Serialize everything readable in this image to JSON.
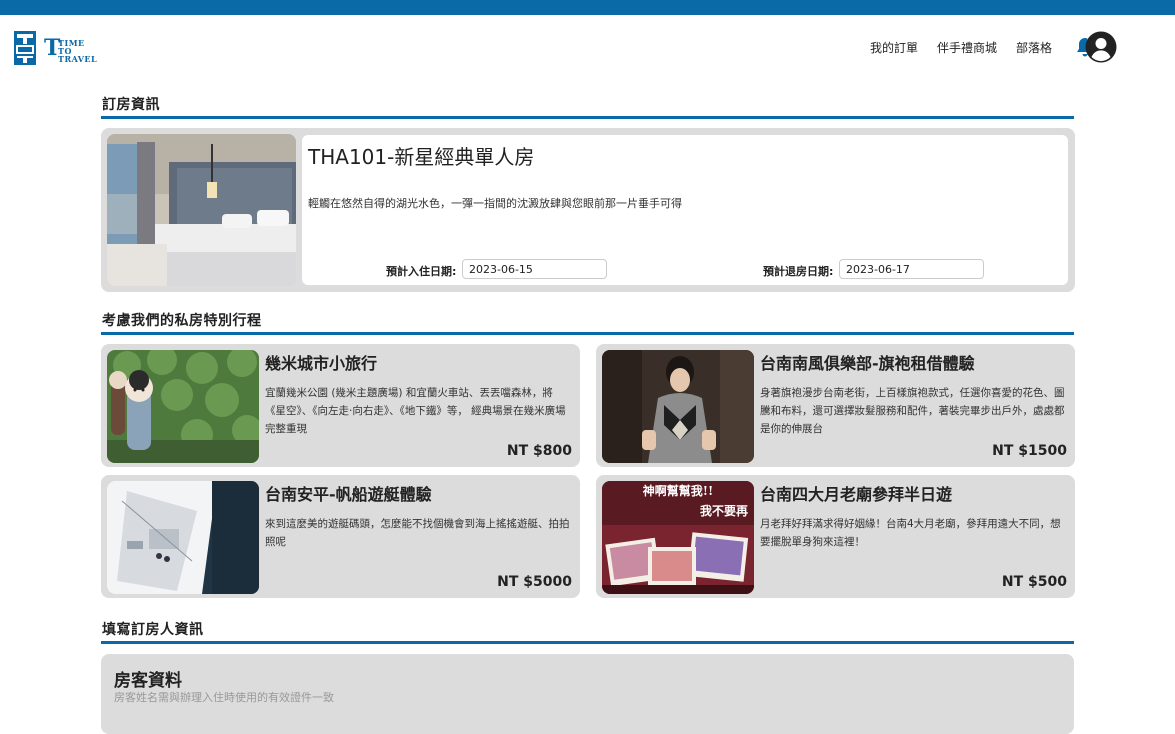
{
  "brand": {
    "name_lines": [
      "TIME",
      "TO",
      "TRAVEL"
    ],
    "color": "#0a6aa8"
  },
  "nav": {
    "items": [
      "我的訂單",
      "伴手禮商城",
      "部落格"
    ]
  },
  "sections": {
    "booking": "訂房資訊",
    "tours": "考慮我們的私房特別行程",
    "guest": "填寫訂房人資訊"
  },
  "booking": {
    "room_title": "THA101-新星經典單人房",
    "description": "輕觸在悠然自得的湖光水色，一彈一指間的沈澱放肆與您眼前那一片垂手可得",
    "checkin_label": "預計入住日期:",
    "checkin_value": "2023-06-15",
    "checkout_label": "預計退房日期:",
    "checkout_value": "2023-06-17"
  },
  "tours": [
    {
      "name": "幾米城市小旅行",
      "text": "宜蘭幾米公園 (幾米主題廣場) 和宜蘭火車站、丟丟噹森林，將《星空》、《向左走·向右走》、《地下鐵》等， 經典場景在幾米廣場完整重現",
      "price": "NT $800"
    },
    {
      "name": "台南南風俱樂部-旗袍租借體驗",
      "text": "身著旗袍漫步台南老街，上百樣旗袍款式，任選你喜愛的花色、圖騰和布料，還可選擇妝髮服務和配件，著裝完畢步出戶外，處處都是你的伸展台",
      "price": "NT $1500"
    },
    {
      "name": "台南安平-帆船遊艇體驗",
      "text": "來到這麼美的遊艇碼頭，怎麼能不找個機會到海上搖搖遊艇、拍拍照呢",
      "price": "NT $5000"
    },
    {
      "name": "台南四大月老廟參拜半日遊",
      "text": "月老拜好拜滿求得好姻緣！台南4大月老廟，參拜用遠大不同，想要擺脫單身狗來這裡！",
      "price": "NT $500",
      "image_caption_lines": [
        "神啊幫幫我!!",
        "我不要再"
      ]
    }
  ],
  "guest": {
    "title": "房客資料",
    "subtitle": "房客姓名需與辦理入住時使用的有效證件一致"
  }
}
